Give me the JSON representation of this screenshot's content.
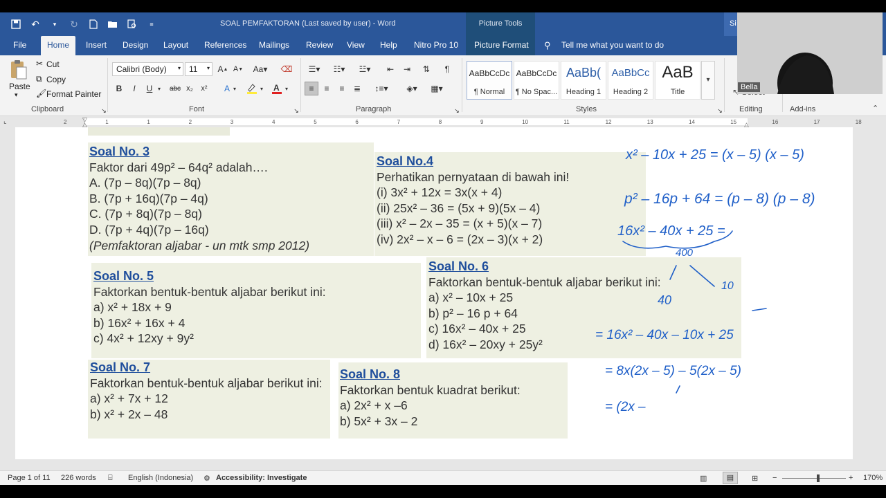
{
  "window": {
    "doc_title": "SOAL PEMFAKTORAN (Last saved by user)  -  Word",
    "context_tab_group": "Picture Tools",
    "signin_fragment": "Si"
  },
  "tabs": [
    "File",
    "Home",
    "Insert",
    "Design",
    "Layout",
    "References",
    "Mailings",
    "Review",
    "View",
    "Help",
    "Nitro Pro 10",
    "Picture Format"
  ],
  "tell_me": "Tell me what you want to do",
  "clipboard": {
    "paste": "Paste",
    "cut": "Cut",
    "copy": "Copy",
    "format_painter": "Format Painter",
    "label": "Clipboard"
  },
  "font": {
    "name": "Calibri (Body)",
    "size": "11",
    "label": "Font"
  },
  "paragraph": {
    "label": "Paragraph"
  },
  "styles": {
    "label": "Styles",
    "items": [
      {
        "sample": "AaBbCcDc",
        "name": "¶ Normal"
      },
      {
        "sample": "AaBbCcDc",
        "name": "¶ No Spac..."
      },
      {
        "sample": "AaBb(",
        "name": "Heading 1"
      },
      {
        "sample": "AaBbCc",
        "name": "Heading 2"
      },
      {
        "sample": "AaB",
        "name": "Title"
      }
    ]
  },
  "editing": {
    "label": "Editing",
    "select": "Select"
  },
  "addins": {
    "label": "Add-ins"
  },
  "webcam": {
    "name": "Bella"
  },
  "ruler_ticks": [
    "2",
    "1",
    "1",
    "2",
    "3",
    "4",
    "5",
    "6",
    "7",
    "8",
    "9",
    "10",
    "11",
    "12",
    "13",
    "14",
    "15",
    "16",
    "17",
    "18"
  ],
  "questions": {
    "q3": {
      "title": "Soal No. 3",
      "lines": [
        "Faktor dari 49p² – 64q² adalah….",
        "A. (7p – 8q)(7p – 8q)",
        "B. (7p + 16q)(7p – 4q)",
        "C. (7p + 8q)(7p – 8q)",
        "D. (7p + 4q)(7p – 16q)"
      ],
      "ref": "(Pemfaktoran aljabar - un mtk smp 2012)"
    },
    "q4": {
      "title": "Soal No.4",
      "lines": [
        "Perhatikan pernyataan di bawah ini!",
        "(i) 3x² + 12x = 3x(x + 4)",
        "(ii) 25x² – 36 = (5x + 9)(5x – 4)",
        "(iii) x² – 2x – 35 = (x + 5)(x – 7)",
        "(iv) 2x² – x – 6 = (2x – 3)(x + 2)"
      ]
    },
    "q5": {
      "title": "Soal No. 5",
      "lines": [
        "Faktorkan bentuk-bentuk aljabar berikut ini:",
        "a) x² + 18x + 9",
        "b) 16x² + 16x + 4",
        "c) 4x² + 12xy + 9y²"
      ]
    },
    "q6": {
      "title": "Soal No. 6",
      "lines": [
        "Faktorkan bentuk-bentuk aljabar berikut ini:",
        "a) x² – 10x + 25",
        "b) p² – 16 p + 64",
        "c) 16x² – 40x + 25",
        "d) 16x² – 20xy + 25y²"
      ]
    },
    "q7": {
      "title": "Soal No. 7",
      "lines": [
        "Faktorkan bentuk-bentuk aljabar berikut ini:",
        "a) x² + 7x + 12",
        "b) x² + 2x – 48"
      ]
    },
    "q8": {
      "title": "Soal No. 8",
      "lines": [
        "Faktorkan bentuk kuadrat berikut:",
        "a) 2x² + x –6",
        "b) 5x² + 3x – 2"
      ]
    }
  },
  "handwriting": [
    "x² – 10x + 25 = (x – 5) (x – 5)",
    "p² – 16p + 64 = (p – 8) (p – 8)",
    "16x² – 40x + 25 =",
    "400",
    "10",
    "40",
    "= 16x² – 40x – 10x + 25",
    "= 8x(2x – 5) – 5(2x – 5)",
    "= (2x –"
  ],
  "status": {
    "page": "Page 1 of 11",
    "words": "226 words",
    "language": "English (Indonesia)",
    "accessibility": "Accessibility: Investigate",
    "zoom": "170%"
  }
}
